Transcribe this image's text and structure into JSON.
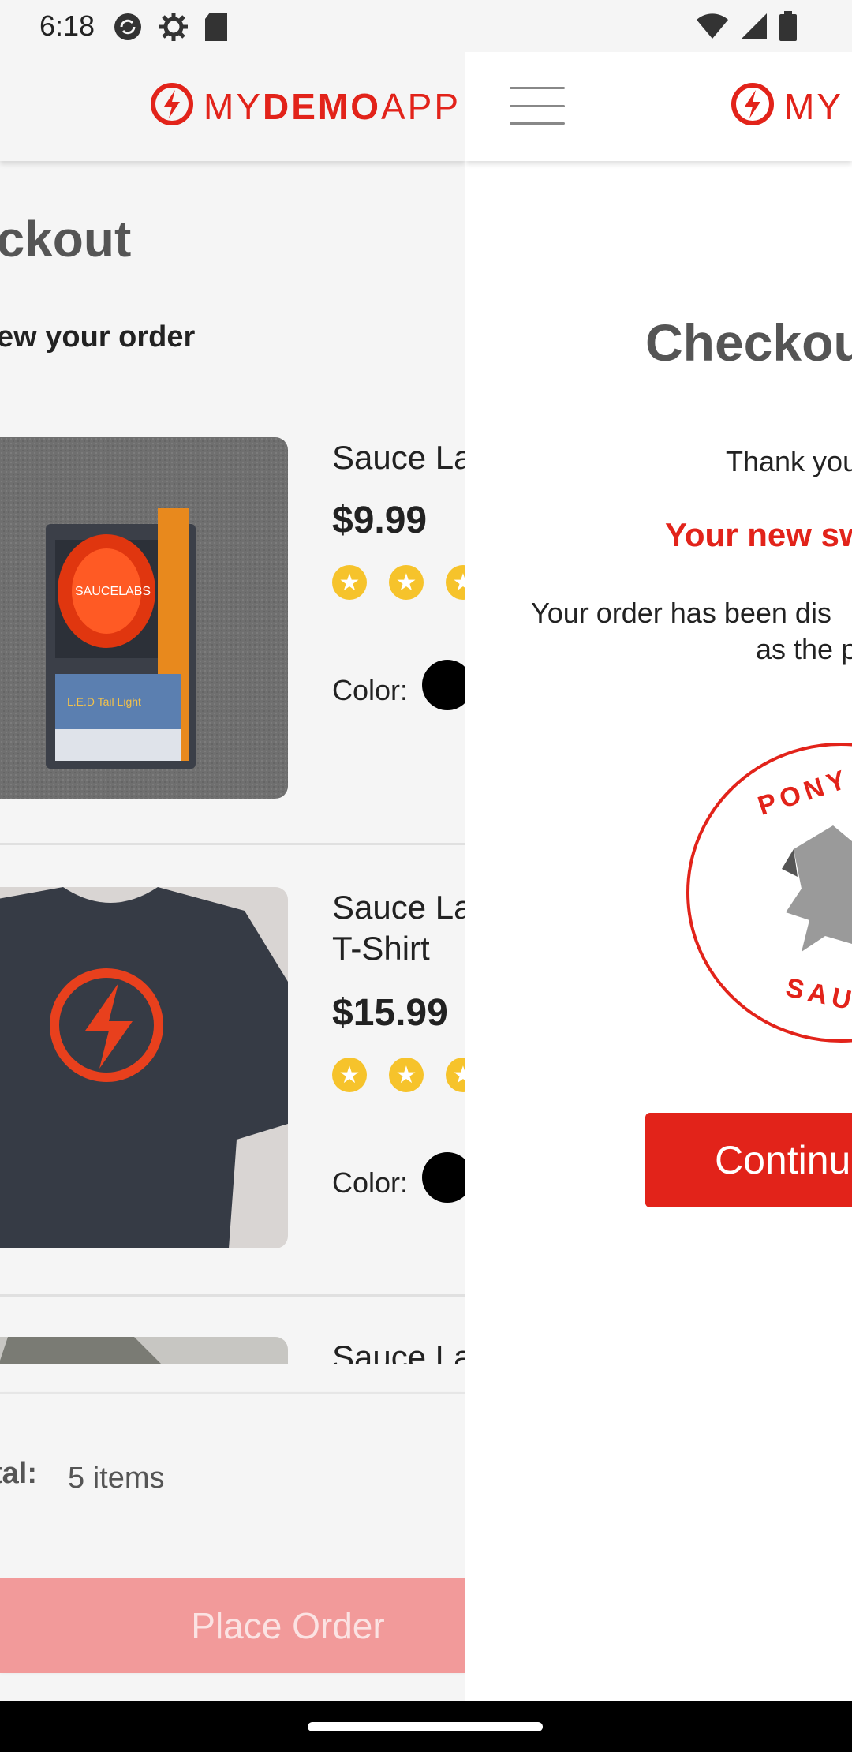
{
  "status_bar": {
    "time": "6:18",
    "icons_left": [
      "sync-icon",
      "settings-icon",
      "sd-card-icon"
    ],
    "icons_right": [
      "wifi-icon",
      "cellular-icon",
      "battery-icon"
    ]
  },
  "brand": {
    "name_my": "MY",
    "name_demo": "DEMO",
    "name_app": "APP",
    "accent_color": "#e2231a"
  },
  "left_page": {
    "title": "eckout",
    "subtitle": "ew your order",
    "items": [
      {
        "name": "Sauce La",
        "price": "$9.99",
        "stars": 3,
        "color_label": "Color:",
        "image_icon": "bike-light-icon"
      },
      {
        "name_line1": "Sauce La",
        "name_line2": "T-Shirt",
        "price": "$15.99",
        "stars": 3,
        "color_label": "Color:",
        "image_icon": "tshirt-icon"
      },
      {
        "name": "Sauce La",
        "image_icon": "jacket-icon"
      }
    ],
    "total_label": "tal:",
    "total_value": "5 items",
    "place_order": "Place Order"
  },
  "right_page": {
    "title": "Checkou",
    "thanks": "Thank you",
    "shipping": "Your new sw",
    "dispatch_line1": "Your order has been dis",
    "dispatch_line2": "as the p",
    "badge_text_top": "PONY",
    "badge_text_bottom": "SAU",
    "continue": "Continu"
  }
}
